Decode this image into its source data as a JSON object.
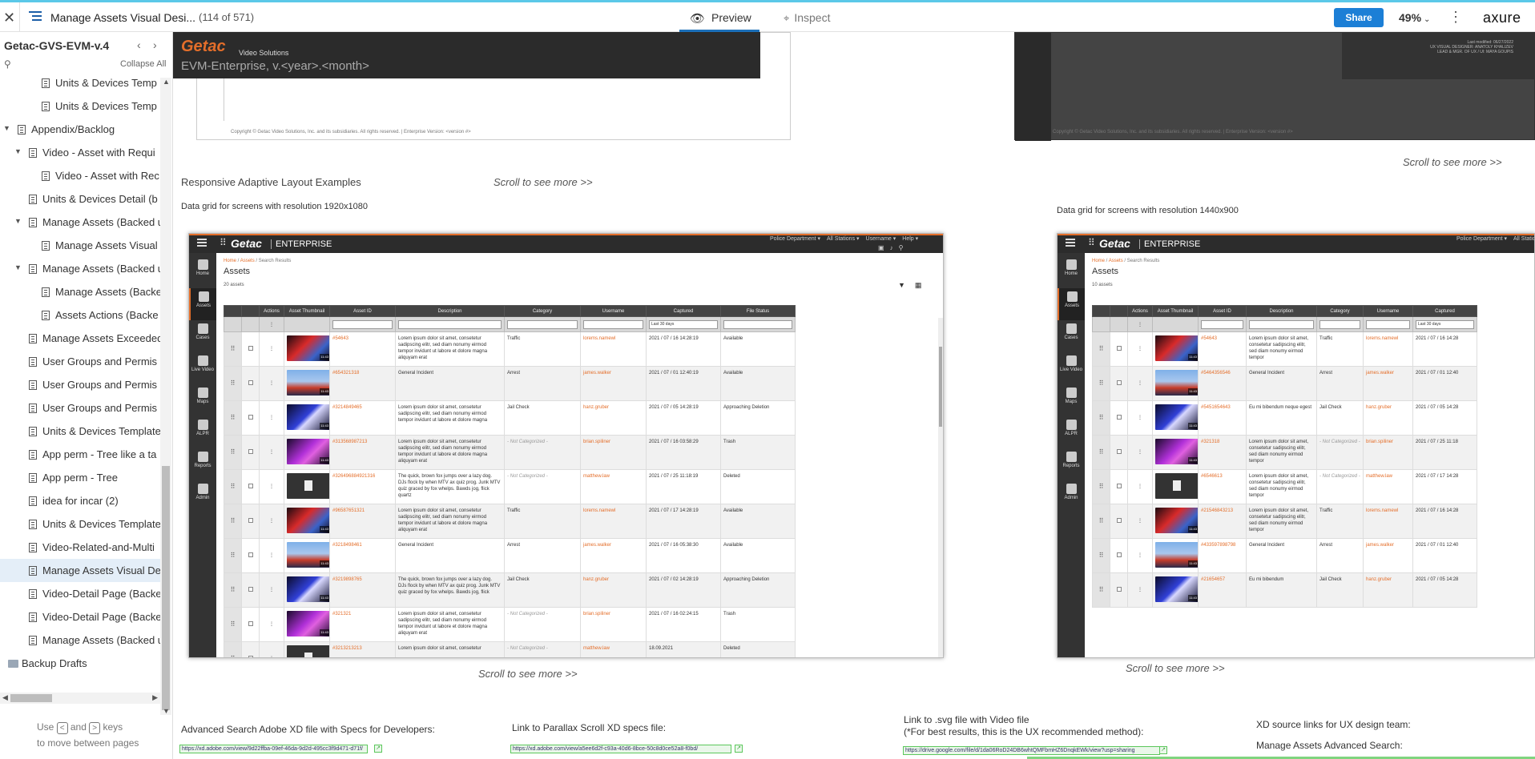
{
  "toolbar": {
    "close_icon": "close-icon",
    "page_title": "Manage Assets Visual Desi...",
    "page_count": "(114 of 571)",
    "preview_label": "Preview",
    "inspect_label": "Inspect",
    "share_label": "Share",
    "zoom": "49%",
    "logo": "axure",
    "accent_color": "#1c7fd6"
  },
  "sidebar": {
    "project_name": "Getac-GVS-EVM-v.4",
    "collapse_all": "Collapse All",
    "items": [
      {
        "label": "Units & Devices Temp",
        "depth": 3,
        "type": "page"
      },
      {
        "label": "Units & Devices Temp",
        "depth": 3,
        "type": "page"
      },
      {
        "label": "Appendix/Backlog",
        "depth": 1,
        "type": "page",
        "expanded": true
      },
      {
        "label": "Video - Asset with Requi",
        "depth": 2,
        "type": "page",
        "expanded": true
      },
      {
        "label": "Video - Asset with Rec",
        "depth": 3,
        "type": "page"
      },
      {
        "label": "Units & Devices Detail (b",
        "depth": 2,
        "type": "page"
      },
      {
        "label": "Manage Assets (Backed u",
        "depth": 2,
        "type": "page",
        "expanded": true
      },
      {
        "label": "Manage Assets Visual",
        "depth": 3,
        "type": "page"
      },
      {
        "label": "Manage Assets (Backed u",
        "depth": 2,
        "type": "page",
        "expanded": true
      },
      {
        "label": "Manage Assets (Backe",
        "depth": 3,
        "type": "page"
      },
      {
        "label": "Assets Actions (Backe",
        "depth": 3,
        "type": "page"
      },
      {
        "label": "Manage Assets Exceeded",
        "depth": 2,
        "type": "page"
      },
      {
        "label": "User Groups and Permis",
        "depth": 2,
        "type": "page"
      },
      {
        "label": "User Groups and Permis",
        "depth": 2,
        "type": "page"
      },
      {
        "label": "User Groups and Permis",
        "depth": 2,
        "type": "page"
      },
      {
        "label": "Units & Devices Template",
        "depth": 2,
        "type": "page"
      },
      {
        "label": "App perm - Tree like a ta",
        "depth": 2,
        "type": "page"
      },
      {
        "label": "App perm - Tree",
        "depth": 2,
        "type": "page"
      },
      {
        "label": "idea for incar (2)",
        "depth": 2,
        "type": "page"
      },
      {
        "label": "Units & Devices Template",
        "depth": 2,
        "type": "page"
      },
      {
        "label": "Video-Related-and-Multi",
        "depth": 2,
        "type": "page"
      },
      {
        "label": "Manage Assets Visual De",
        "depth": 2,
        "type": "page",
        "selected": true
      },
      {
        "label": "Video-Detail Page (Backe",
        "depth": 2,
        "type": "page"
      },
      {
        "label": "Video-Detail Page (Backe",
        "depth": 2,
        "type": "page"
      },
      {
        "label": "Manage Assets (Backed u",
        "depth": 2,
        "type": "page"
      },
      {
        "label": "Backup Drafts",
        "depth": 0,
        "type": "folder",
        "collapsed": true
      }
    ],
    "help_use": "Use",
    "help_and": "and",
    "help_keys": "keys",
    "help_line2": "to move between pages"
  },
  "canvas": {
    "card1": {
      "logo": "Getac",
      "subtitle": "Video Solutions",
      "version": "EVM-Enterprise,   v.<year>.<month>",
      "copyright": "Copyright © Getac Video Solutions, Inc. and its subsidiaries. All rights reserved.  |  Enterprise Version: <version #>"
    },
    "card2": {
      "meta1": "Last modified: 06/27/2022",
      "meta2": "UX VISUAL DESIGNER: ANATOLY KHALIZEV",
      "meta3": "LEAD & MGR. OF UX / UI: MAYA GOUPIS",
      "copyright": "Copyright © Getac Video Solutions, Inc. and its subsidiaries. All rights reserved.  |  Enterprise Version: <version #>"
    },
    "scroll_hint": "Scroll to see more >>",
    "section_title": "Responsive Adaptive Layout Examples",
    "label_1920": "Data grid for screens with resolution 1920x1080",
    "label_1440": "Data grid for screens with resolution 1440x900",
    "adobe_title": "Advanced Search Adobe XD file with Specs for Developers:",
    "adobe_url": "https://xd.adobe.com/view/9d22ffba-09ef-46da-9d2d-495cc3f9d471-d71f/",
    "parallax_title": "Link to Parallax Scroll XD specs file:",
    "parallax_url": "https://xd.adobe.com/view/a5ee6d2f-c93a-40d6-8bce-50c8d0ce52a8-f0bd/",
    "svg_title_1": "Link to .svg file with Video file",
    "svg_title_2": "(*For best results, this is the UX recommended method):",
    "svg_url": "https://drive.google.com/file/d/1da06RoD24DB6whtQMFbmHZ6DnqkEWk/view?usp=sharing",
    "xd_source_title": "XD source links for UX design team:",
    "xd_source_sub": "Manage Assets Advanced Search:"
  },
  "mock": {
    "brand": "Getac",
    "edition": "ENTERPRISE",
    "menu_dept": "Police Department ▾",
    "menu_stations": "All Stations ▾",
    "menu_user": "Username ▾",
    "menu_help": "Help ▾",
    "crumb_home": "Home",
    "crumb_assets": "Assets",
    "crumb_results": "Search Results",
    "title": "Assets",
    "count_1920": "20 assets",
    "count_1440": "10 assets",
    "nav": [
      "Home",
      "Assets",
      "Cases",
      "Live Video",
      "Maps",
      "ALPR",
      "Reports",
      "Admin"
    ],
    "columns": [
      "Actions",
      "Asset Thumbnail",
      "Asset ID",
      "Description",
      "Category",
      "Username",
      "Captured",
      "File Status"
    ],
    "filter_captured": "Last 30 days",
    "brand_color": "#e46e2a",
    "rows_1920": [
      {
        "id": "#54643",
        "desc": "Lorem ipsum dolor sit amet, consetetur sadipscing elitr, sed diam nonumy eirmod tempor invidunt ut labore et dolore magna aliquyam erat",
        "cat": "Traffic",
        "user": "lorems.namewl",
        "cap": "2021 / 07 / 16    14:28:19",
        "status": "Available",
        "thumb": "red"
      },
      {
        "id": "#654321318",
        "desc": "General Incident",
        "cat": "Arrest",
        "user": "james.walker",
        "cap": "2021 / 07 / 01    12:40:19",
        "status": "Available",
        "thumb": "sky"
      },
      {
        "id": "#3214849465",
        "desc": "Lorem ipsum dolor sit amet, consetetur sadipscing elitr, sed diam nonumy eirmod tempor invidunt ut labore et dolore magna",
        "cat": "Jail Check",
        "user": "hanz.gruber",
        "cap": "2021 / 07 / 05    14:28:19",
        "status": "Approaching Deletion",
        "thumb": "blue"
      },
      {
        "id": "#313568987213",
        "desc": "Lorem ipsum dolor sit amet, consetetur sadipscing elitr, sed diam nonumy eirmod tempor invidunt ut labore et dolore magna aliquyam erat",
        "cat": "- Not Categorized -",
        "user": "brian.spiliner",
        "cap": "2021 / 07 / 16    03:58:29",
        "status": "Trash",
        "thumb": "purple"
      },
      {
        "id": "#326496884921316",
        "desc": "The quick, brown fox jumps over a lazy dog. DJs flock by when MTV ax quiz prog. Junk MTV quiz graced by fox whelps. Bawds jog, flick quartz",
        "cat": "- Not Categorized -",
        "user": "matthew.law",
        "cap": "2021 / 07 / 25    11:18:19",
        "status": "Deleted",
        "thumb": "doc"
      },
      {
        "id": "#96587651321",
        "desc": "Lorem ipsum dolor sit amet, consetetur sadipscing elitr, sed diam nonumy eirmod tempor invidunt ut labore et dolore magna aliquyam erat",
        "cat": "Traffic",
        "user": "lorems.namewl",
        "cap": "2021 / 07 / 17    14:28:19",
        "status": "Available",
        "thumb": "red"
      },
      {
        "id": "#3218498461",
        "desc": "General Incident",
        "cat": "Arrest",
        "user": "james.walker",
        "cap": "2021 / 07 / 16    05:38:30",
        "status": "Available",
        "thumb": "sky"
      },
      {
        "id": "#3219898765",
        "desc": "The quick, brown fox jumps over a lazy dog. DJs flock by when MTV ax quiz prog. Junk MTV quiz graced by fox whelps. Bawds jog, flick",
        "cat": "Jail Check",
        "user": "hanz.gruber",
        "cap": "2021 / 07 / 02    14:28:19",
        "status": "Approaching Deletion",
        "thumb": "blue"
      },
      {
        "id": "#321321",
        "desc": "Lorem ipsum dolor sit amet, consetetur sadipscing elitr, sed diam nonumy eirmod tempor invidunt ut labore et dolore magna aliquyam erat",
        "cat": "- Not Categorized -",
        "user": "brian.spiliner",
        "cap": "2021 / 07 / 16    02:24:15",
        "status": "Trash",
        "thumb": "purple"
      },
      {
        "id": "#3213213213",
        "desc": "Lorem ipsum dolor sit amet, consetetur",
        "cat": "- Not Categorized -",
        "user": "matthew.law",
        "cap": "18.09.2021",
        "status": "Deleted",
        "thumb": "doc"
      }
    ],
    "rows_1440": [
      {
        "id": "#54643",
        "desc": "Lorem ipsum dolor sit amet, consetetur sadipscing elitr, sed diam nonumy eirmod tempor",
        "cat": "Traffic",
        "user": "lorems.namewl",
        "cap": "2021 / 07 / 16    14:28",
        "thumb": "red"
      },
      {
        "id": "#5464356546",
        "desc": "General Incident",
        "cat": "Arrest",
        "user": "james.walker",
        "cap": "2021 / 07 / 01    12:40",
        "thumb": "sky"
      },
      {
        "id": "#5451654643",
        "desc": "Eu mi bibendum neque egest",
        "cat": "Jail Check",
        "user": "hanz.gruber",
        "cap": "2021 / 07 / 05    14:28",
        "thumb": "blue"
      },
      {
        "id": "#321318",
        "desc": "Lorem ipsum dolor sit amet, consetetur sadipscing elitr, sed diam nonumy eirmod tempor",
        "cat": "- Not Categorized -",
        "user": "brian.spiliner",
        "cap": "2021 / 07 / 25    11:18",
        "thumb": "purple"
      },
      {
        "id": "#6546613",
        "desc": "Lorem ipsum dolor sit amet, consetetur sadipscing elitr, sed diam nonumy eirmod tempor",
        "cat": "- Not Categorized -",
        "user": "matthew.law",
        "cap": "2021 / 07 / 17    14:28",
        "thumb": "doc"
      },
      {
        "id": "#21546843213",
        "desc": "Lorem ipsum dolor sit amet, consetetur sadipscing elitr, sed diam nonumy eirmod tempor",
        "cat": "Traffic",
        "user": "lorems.namewl",
        "cap": "2021 / 07 / 16    14:28",
        "thumb": "red"
      },
      {
        "id": "#433597898798",
        "desc": "General Incident",
        "cat": "Arrest",
        "user": "james.walker",
        "cap": "2021 / 07 / 01    12:40",
        "thumb": "sky"
      },
      {
        "id": "#21654657",
        "desc": "Eu mi bibendum",
        "cat": "Jail Check",
        "user": "hanz.gruber",
        "cap": "2021 / 07 / 05    14:28",
        "thumb": "blue"
      }
    ]
  }
}
